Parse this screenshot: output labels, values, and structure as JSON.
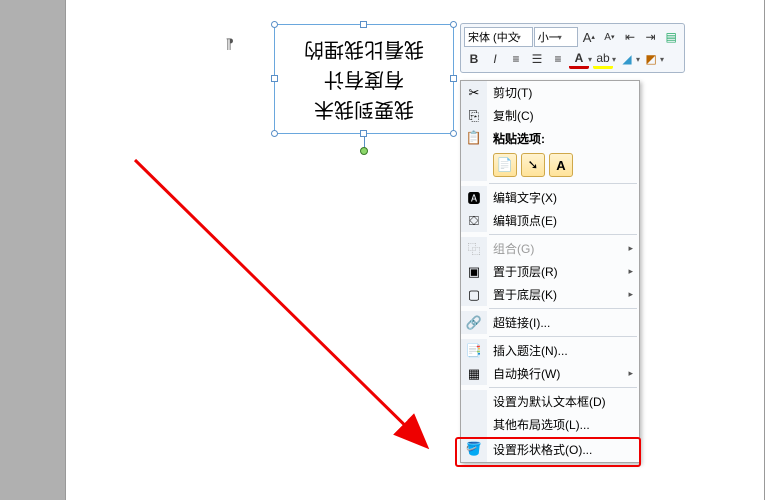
{
  "textbox": {
    "line1": "我要到我未",
    "line2": "有度有计",
    "line3": "我看比我埋的"
  },
  "mini": {
    "font": "宋体 (中文",
    "size": "小一"
  },
  "ctx": {
    "cut": "剪切(T)",
    "copy": "复制(C)",
    "paste_hdr": "粘贴选项:",
    "edit_text": "编辑文字(X)",
    "edit_points": "编辑顶点(E)",
    "group": "组合(G)",
    "bring_front": "置于顶层(R)",
    "send_back": "置于底层(K)",
    "hyperlink": "超链接(I)...",
    "caption": "插入题注(N)...",
    "wrap": "自动换行(W)",
    "set_default": "设置为默认文本框(D)",
    "more_layout": "其他布局选项(L)...",
    "format_shape": "设置形状格式(O)..."
  }
}
